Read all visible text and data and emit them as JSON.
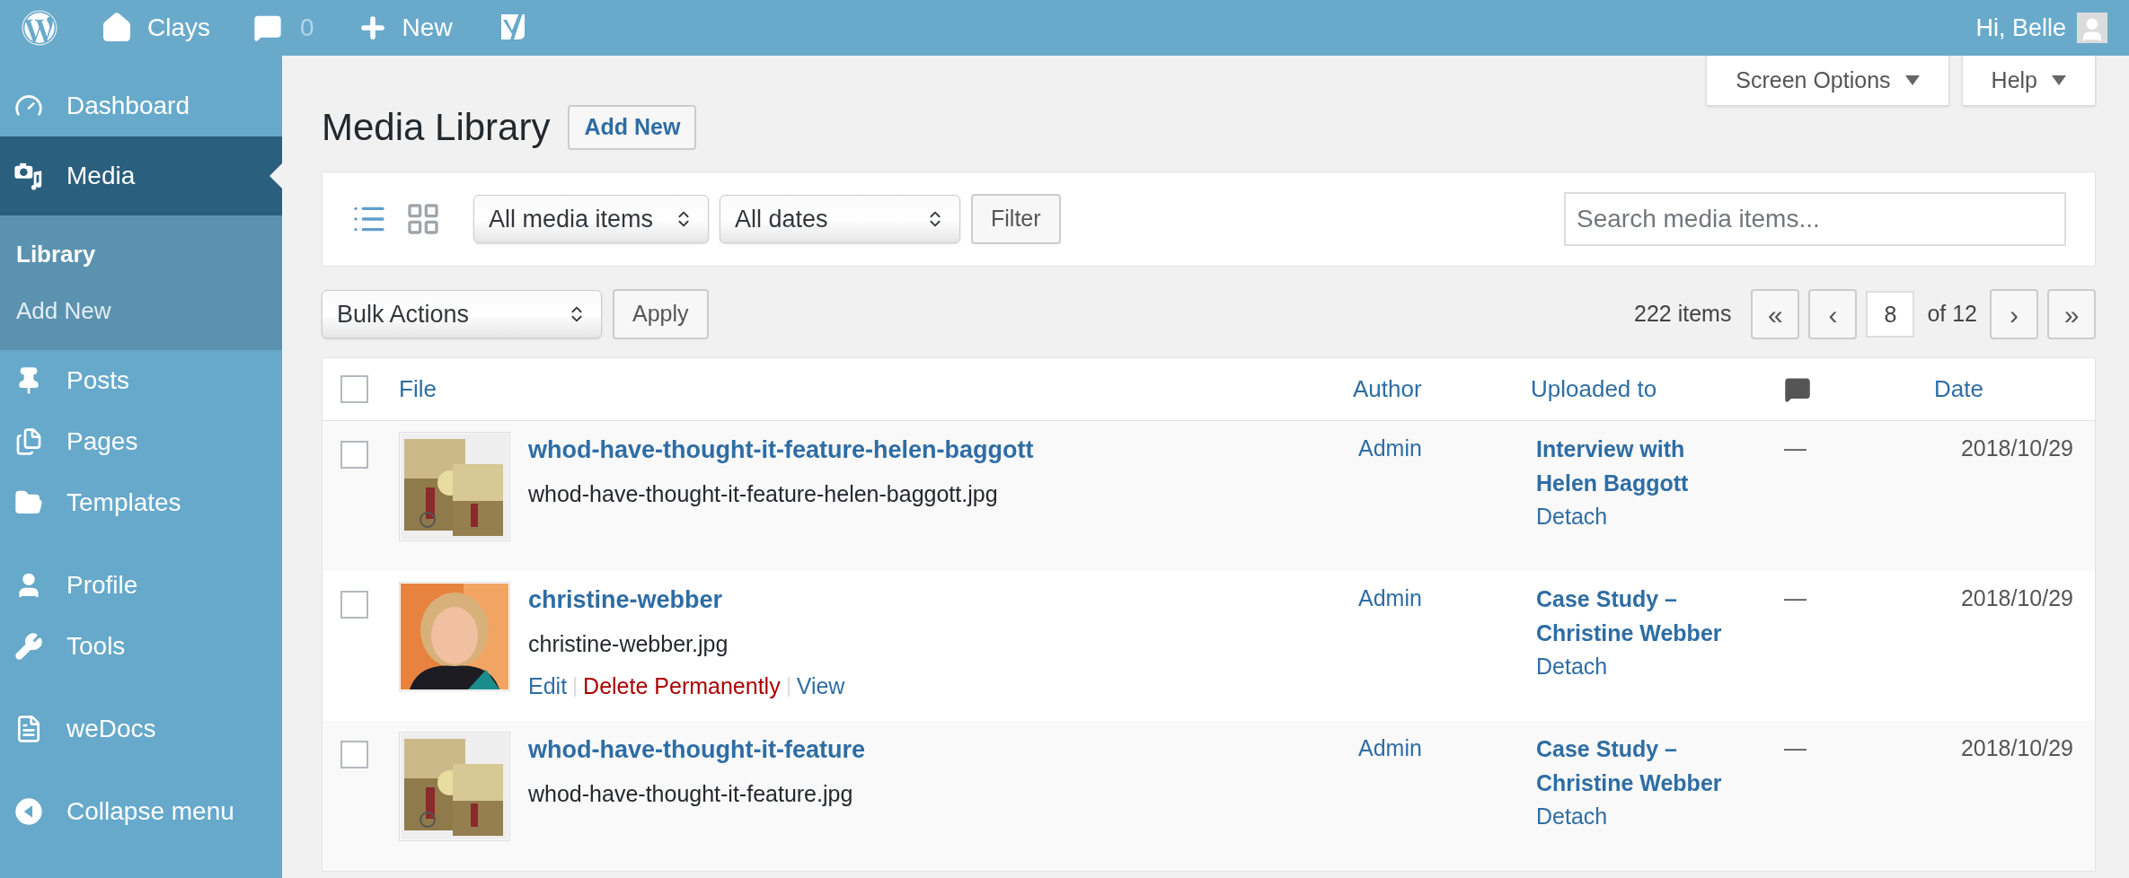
{
  "topbar": {
    "items": [
      {
        "kind": "logo"
      },
      {
        "kind": "site",
        "label": "Clays"
      },
      {
        "kind": "comments",
        "label": "0"
      },
      {
        "kind": "new",
        "label": "New"
      },
      {
        "kind": "seo"
      }
    ],
    "greeting": "Hi, Belle"
  },
  "sidebar": {
    "items": [
      {
        "kind": "dashboard",
        "label": "Dashboard",
        "selected": false
      },
      {
        "kind": "media",
        "label": "Media",
        "selected": true,
        "children": [
          {
            "label": "Library",
            "selected": true
          },
          {
            "label": "Add New",
            "selected": false
          }
        ]
      },
      {
        "kind": "posts",
        "label": "Posts",
        "selected": false
      },
      {
        "kind": "pages",
        "label": "Pages",
        "selected": false
      },
      {
        "kind": "templates",
        "label": "Templates",
        "selected": false
      },
      {
        "kind": "profile",
        "label": "Profile",
        "selected": false
      },
      {
        "kind": "tools",
        "label": "Tools",
        "selected": false
      },
      {
        "kind": "docs",
        "label": "weDocs",
        "selected": false
      },
      {
        "kind": "collapse",
        "label": "Collapse menu",
        "selected": false
      }
    ]
  },
  "header_tabs": [
    "Screen Options",
    "Help"
  ],
  "page": {
    "title": "Media Library",
    "add_button": "Add New"
  },
  "filters": {
    "views": [
      {
        "kind": "list",
        "selected": true
      },
      {
        "kind": "grid",
        "selected": false
      }
    ],
    "type_select": "All media items",
    "date_select": "All dates",
    "filter_button": "Filter",
    "search": {
      "placeholder": "Search media items..."
    }
  },
  "bulk": {
    "select": "Bulk Actions",
    "apply": "Apply"
  },
  "pagination": {
    "count": "222 items",
    "first": "«",
    "prev": "‹",
    "page": "8",
    "of": "of 12",
    "next": "›",
    "last": "»"
  },
  "table": {
    "header_checked": false,
    "columns": [
      "File",
      "Author",
      "Uploaded to",
      "Date"
    ],
    "rows": [
      {
        "checked": false,
        "title": "whod-have-thought-it-feature-helen-baggott",
        "filename": "whod-have-thought-it-feature-helen-baggott.jpg",
        "actions": [],
        "author": "Admin",
        "uploaded_to": "Interview with Helen Baggott",
        "detach": "Detach",
        "comments": "—",
        "date": "2018/10/29"
      },
      {
        "checked": false,
        "title": "christine-webber",
        "filename": "christine-webber.jpg",
        "actions": [
          {
            "label": "Edit",
            "kind": "link"
          },
          {
            "label": "Delete Permanently",
            "kind": "danger"
          },
          {
            "label": "View",
            "kind": "link"
          }
        ],
        "author": "Admin",
        "uploaded_to": "Case Study – Christine Webber",
        "detach": "Detach",
        "comments": "—",
        "date": "2018/10/29"
      },
      {
        "checked": false,
        "title": "whod-have-thought-it-feature",
        "filename": "whod-have-thought-it-feature.jpg",
        "actions": [],
        "author": "Admin",
        "uploaded_to": "Case Study – Christine Webber",
        "detach": "Detach",
        "comments": "—",
        "date": "2018/10/29"
      }
    ]
  }
}
